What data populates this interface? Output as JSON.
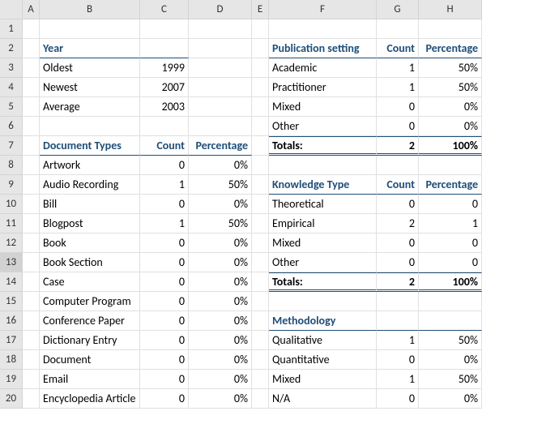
{
  "columns": [
    "A",
    "B",
    "C",
    "D",
    "E",
    "F",
    "G",
    "H"
  ],
  "rows": [
    "1",
    "2",
    "3",
    "4",
    "5",
    "6",
    "7",
    "8",
    "9",
    "10",
    "11",
    "12",
    "13",
    "14",
    "15",
    "16",
    "17",
    "18",
    "19",
    "20"
  ],
  "selectedRow": "13",
  "left": {
    "yearHeader": "Year",
    "yearRows": [
      {
        "label": "Oldest",
        "value": "1999"
      },
      {
        "label": "Newest",
        "value": "2007"
      },
      {
        "label": "Average",
        "value": "2003"
      }
    ],
    "docHeader": {
      "label": "Document Types",
      "count": "Count",
      "pct": "Percentage"
    },
    "docRows": [
      {
        "label": "Artwork",
        "count": "0",
        "pct": "0%"
      },
      {
        "label": "Audio Recording",
        "count": "1",
        "pct": "50%"
      },
      {
        "label": "Bill",
        "count": "0",
        "pct": "0%"
      },
      {
        "label": "Blogpost",
        "count": "1",
        "pct": "50%"
      },
      {
        "label": "Book",
        "count": "0",
        "pct": "0%"
      },
      {
        "label": "Book Section",
        "count": "0",
        "pct": "0%"
      },
      {
        "label": "Case",
        "count": "0",
        "pct": "0%"
      },
      {
        "label": "Computer Program",
        "count": "0",
        "pct": "0%"
      },
      {
        "label": "Conference Paper",
        "count": "0",
        "pct": "0%"
      },
      {
        "label": "Dictionary Entry",
        "count": "0",
        "pct": "0%"
      },
      {
        "label": "Document",
        "count": "0",
        "pct": "0%"
      },
      {
        "label": "Email",
        "count": "0",
        "pct": "0%"
      },
      {
        "label": "Encyclopedia Article",
        "count": "0",
        "pct": "0%"
      }
    ]
  },
  "right": {
    "pubHeader": {
      "label": "Publication setting",
      "count": "Count",
      "pct": "Percentage"
    },
    "pubRows": [
      {
        "label": "Academic",
        "count": "1",
        "pct": "50%"
      },
      {
        "label": "Practitioner",
        "count": "1",
        "pct": "50%"
      },
      {
        "label": "Mixed",
        "count": "0",
        "pct": "0%"
      },
      {
        "label": "Other",
        "count": "0",
        "pct": "0%"
      }
    ],
    "pubTotal": {
      "label": "Totals:",
      "count": "2",
      "pct": "100%"
    },
    "knowHeader": {
      "label": "Knowledge Type",
      "count": "Count",
      "pct": "Percentage"
    },
    "knowRows": [
      {
        "label": "Theoretical",
        "count": "0",
        "pct": "0"
      },
      {
        "label": "Empirical",
        "count": "2",
        "pct": "1"
      },
      {
        "label": "Mixed",
        "count": "0",
        "pct": "0"
      },
      {
        "label": "Other",
        "count": "0",
        "pct": "0"
      }
    ],
    "knowTotal": {
      "label": "Totals:",
      "count": "2",
      "pct": "100%"
    },
    "methHeader": {
      "label": "Methodology"
    },
    "methRows": [
      {
        "label": "Qualitative",
        "count": "1",
        "pct": "50%"
      },
      {
        "label": "Quantitative",
        "count": "0",
        "pct": "0%"
      },
      {
        "label": "Mixed",
        "count": "1",
        "pct": "50%"
      },
      {
        "label": "N/A",
        "count": "0",
        "pct": "0%"
      }
    ]
  }
}
